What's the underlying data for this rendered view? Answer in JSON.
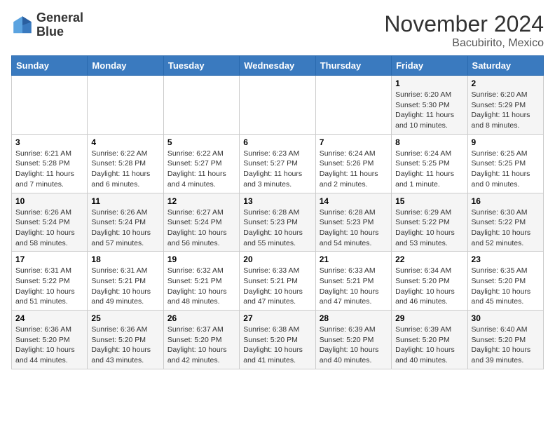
{
  "logo": {
    "line1": "General",
    "line2": "Blue"
  },
  "title": "November 2024",
  "location": "Bacubirito, Mexico",
  "days_of_week": [
    "Sunday",
    "Monday",
    "Tuesday",
    "Wednesday",
    "Thursday",
    "Friday",
    "Saturday"
  ],
  "weeks": [
    [
      {
        "day": "",
        "sunrise": "",
        "sunset": "",
        "daylight": "",
        "empty": true
      },
      {
        "day": "",
        "sunrise": "",
        "sunset": "",
        "daylight": "",
        "empty": true
      },
      {
        "day": "",
        "sunrise": "",
        "sunset": "",
        "daylight": "",
        "empty": true
      },
      {
        "day": "",
        "sunrise": "",
        "sunset": "",
        "daylight": "",
        "empty": true
      },
      {
        "day": "",
        "sunrise": "",
        "sunset": "",
        "daylight": "",
        "empty": true
      },
      {
        "day": "1",
        "sunrise": "Sunrise: 6:20 AM",
        "sunset": "Sunset: 5:30 PM",
        "daylight": "Daylight: 11 hours and 10 minutes."
      },
      {
        "day": "2",
        "sunrise": "Sunrise: 6:20 AM",
        "sunset": "Sunset: 5:29 PM",
        "daylight": "Daylight: 11 hours and 8 minutes."
      }
    ],
    [
      {
        "day": "3",
        "sunrise": "Sunrise: 6:21 AM",
        "sunset": "Sunset: 5:28 PM",
        "daylight": "Daylight: 11 hours and 7 minutes."
      },
      {
        "day": "4",
        "sunrise": "Sunrise: 6:22 AM",
        "sunset": "Sunset: 5:28 PM",
        "daylight": "Daylight: 11 hours and 6 minutes."
      },
      {
        "day": "5",
        "sunrise": "Sunrise: 6:22 AM",
        "sunset": "Sunset: 5:27 PM",
        "daylight": "Daylight: 11 hours and 4 minutes."
      },
      {
        "day": "6",
        "sunrise": "Sunrise: 6:23 AM",
        "sunset": "Sunset: 5:27 PM",
        "daylight": "Daylight: 11 hours and 3 minutes."
      },
      {
        "day": "7",
        "sunrise": "Sunrise: 6:24 AM",
        "sunset": "Sunset: 5:26 PM",
        "daylight": "Daylight: 11 hours and 2 minutes."
      },
      {
        "day": "8",
        "sunrise": "Sunrise: 6:24 AM",
        "sunset": "Sunset: 5:25 PM",
        "daylight": "Daylight: 11 hours and 1 minute."
      },
      {
        "day": "9",
        "sunrise": "Sunrise: 6:25 AM",
        "sunset": "Sunset: 5:25 PM",
        "daylight": "Daylight: 11 hours and 0 minutes."
      }
    ],
    [
      {
        "day": "10",
        "sunrise": "Sunrise: 6:26 AM",
        "sunset": "Sunset: 5:24 PM",
        "daylight": "Daylight: 10 hours and 58 minutes."
      },
      {
        "day": "11",
        "sunrise": "Sunrise: 6:26 AM",
        "sunset": "Sunset: 5:24 PM",
        "daylight": "Daylight: 10 hours and 57 minutes."
      },
      {
        "day": "12",
        "sunrise": "Sunrise: 6:27 AM",
        "sunset": "Sunset: 5:24 PM",
        "daylight": "Daylight: 10 hours and 56 minutes."
      },
      {
        "day": "13",
        "sunrise": "Sunrise: 6:28 AM",
        "sunset": "Sunset: 5:23 PM",
        "daylight": "Daylight: 10 hours and 55 minutes."
      },
      {
        "day": "14",
        "sunrise": "Sunrise: 6:28 AM",
        "sunset": "Sunset: 5:23 PM",
        "daylight": "Daylight: 10 hours and 54 minutes."
      },
      {
        "day": "15",
        "sunrise": "Sunrise: 6:29 AM",
        "sunset": "Sunset: 5:22 PM",
        "daylight": "Daylight: 10 hours and 53 minutes."
      },
      {
        "day": "16",
        "sunrise": "Sunrise: 6:30 AM",
        "sunset": "Sunset: 5:22 PM",
        "daylight": "Daylight: 10 hours and 52 minutes."
      }
    ],
    [
      {
        "day": "17",
        "sunrise": "Sunrise: 6:31 AM",
        "sunset": "Sunset: 5:22 PM",
        "daylight": "Daylight: 10 hours and 51 minutes."
      },
      {
        "day": "18",
        "sunrise": "Sunrise: 6:31 AM",
        "sunset": "Sunset: 5:21 PM",
        "daylight": "Daylight: 10 hours and 49 minutes."
      },
      {
        "day": "19",
        "sunrise": "Sunrise: 6:32 AM",
        "sunset": "Sunset: 5:21 PM",
        "daylight": "Daylight: 10 hours and 48 minutes."
      },
      {
        "day": "20",
        "sunrise": "Sunrise: 6:33 AM",
        "sunset": "Sunset: 5:21 PM",
        "daylight": "Daylight: 10 hours and 47 minutes."
      },
      {
        "day": "21",
        "sunrise": "Sunrise: 6:33 AM",
        "sunset": "Sunset: 5:21 PM",
        "daylight": "Daylight: 10 hours and 47 minutes."
      },
      {
        "day": "22",
        "sunrise": "Sunrise: 6:34 AM",
        "sunset": "Sunset: 5:20 PM",
        "daylight": "Daylight: 10 hours and 46 minutes."
      },
      {
        "day": "23",
        "sunrise": "Sunrise: 6:35 AM",
        "sunset": "Sunset: 5:20 PM",
        "daylight": "Daylight: 10 hours and 45 minutes."
      }
    ],
    [
      {
        "day": "24",
        "sunrise": "Sunrise: 6:36 AM",
        "sunset": "Sunset: 5:20 PM",
        "daylight": "Daylight: 10 hours and 44 minutes."
      },
      {
        "day": "25",
        "sunrise": "Sunrise: 6:36 AM",
        "sunset": "Sunset: 5:20 PM",
        "daylight": "Daylight: 10 hours and 43 minutes."
      },
      {
        "day": "26",
        "sunrise": "Sunrise: 6:37 AM",
        "sunset": "Sunset: 5:20 PM",
        "daylight": "Daylight: 10 hours and 42 minutes."
      },
      {
        "day": "27",
        "sunrise": "Sunrise: 6:38 AM",
        "sunset": "Sunset: 5:20 PM",
        "daylight": "Daylight: 10 hours and 41 minutes."
      },
      {
        "day": "28",
        "sunrise": "Sunrise: 6:39 AM",
        "sunset": "Sunset: 5:20 PM",
        "daylight": "Daylight: 10 hours and 40 minutes."
      },
      {
        "day": "29",
        "sunrise": "Sunrise: 6:39 AM",
        "sunset": "Sunset: 5:20 PM",
        "daylight": "Daylight: 10 hours and 40 minutes."
      },
      {
        "day": "30",
        "sunrise": "Sunrise: 6:40 AM",
        "sunset": "Sunset: 5:20 PM",
        "daylight": "Daylight: 10 hours and 39 minutes."
      }
    ]
  ]
}
